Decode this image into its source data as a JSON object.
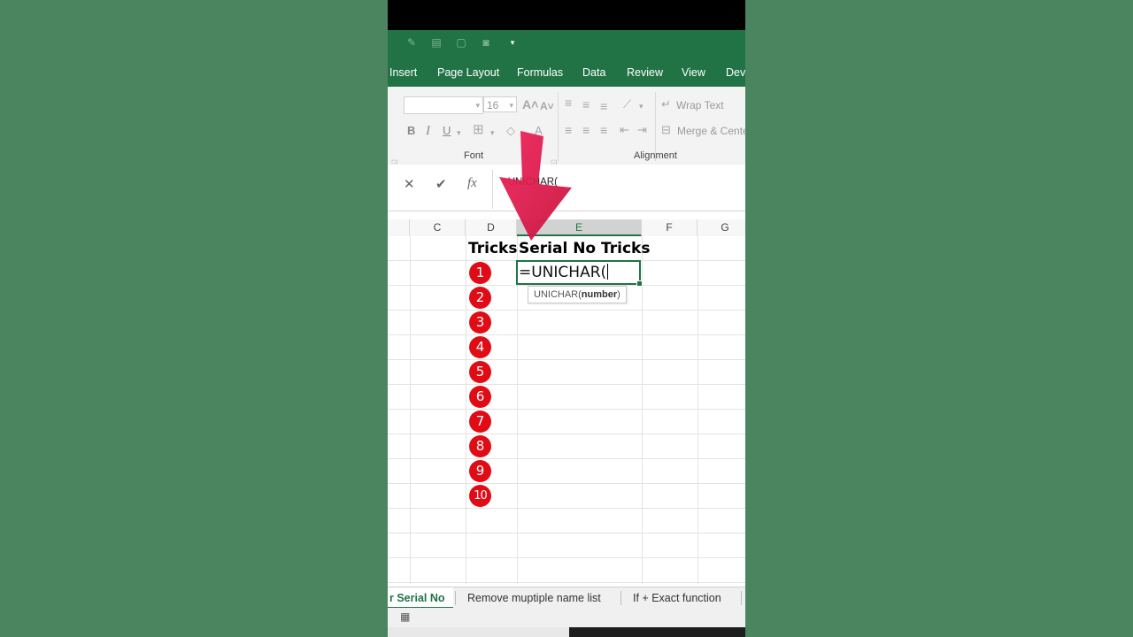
{
  "ribbon_tabs": [
    "Insert",
    "Page Layout",
    "Formulas",
    "Data",
    "Review",
    "View",
    "Dev"
  ],
  "ribbon": {
    "font_size": "16",
    "bold": "B",
    "italic": "I",
    "underline": "U",
    "wrap_text": "Wrap Text",
    "merge_center": "Merge & Cente",
    "font_group": "Font",
    "alignment_group": "Alignment"
  },
  "formula_bar": {
    "cancel": "✕",
    "enter": "✔",
    "fx": "fx",
    "text": "=UNICHAR("
  },
  "columns": [
    "C",
    "D",
    "E",
    "F",
    "G"
  ],
  "selected_column": "E",
  "sheet": {
    "header_tricks": "Tricks",
    "header_serial": "Serial No Tricks",
    "serial_numbers": [
      "1",
      "2",
      "3",
      "4",
      "5",
      "6",
      "7",
      "8",
      "9",
      "10"
    ],
    "active_cell_text": "=UNICHAR(",
    "tooltip_function": "UNICHAR(",
    "tooltip_arg": "number",
    "tooltip_close": ")"
  },
  "sheet_tabs": [
    "r Serial No",
    "Remove muptiple name list",
    "If + Exact  function"
  ],
  "active_sheet_tab": "r Serial No",
  "colors": {
    "excel_green": "#217346",
    "badge_red": "#e00b14",
    "arrow_pink": "#e8154a",
    "side_background": "#4a8560"
  }
}
